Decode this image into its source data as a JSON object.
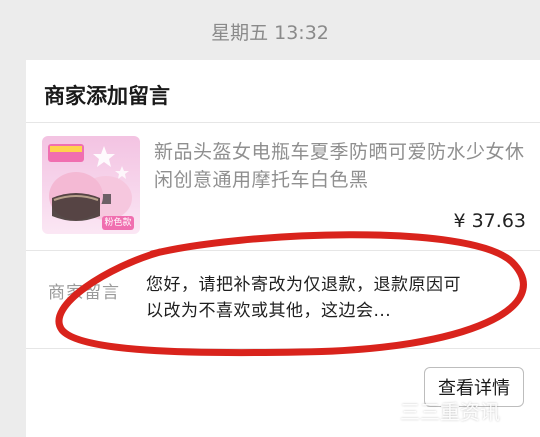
{
  "timestamp": "星期五 13:32",
  "card": {
    "title": "商家添加留言",
    "product": {
      "title": "新品头盔女电瓶车夏季防晒可爱防水少女休闲创意通用摩托车白色黑",
      "price": "¥ 37.63",
      "image_badge": "粉色款"
    },
    "message": {
      "label": "商家留言",
      "text": "您好，请把补寄改为仅退款，退款原因可以改为不喜欢或其他，这边会..."
    },
    "detail_button": "查看详情"
  },
  "watermark": "三三重资讯",
  "colors": {
    "background": "#ececec",
    "card": "#ffffff",
    "annotation": "#d9231c",
    "thumbnail": "#f3c3e2"
  }
}
